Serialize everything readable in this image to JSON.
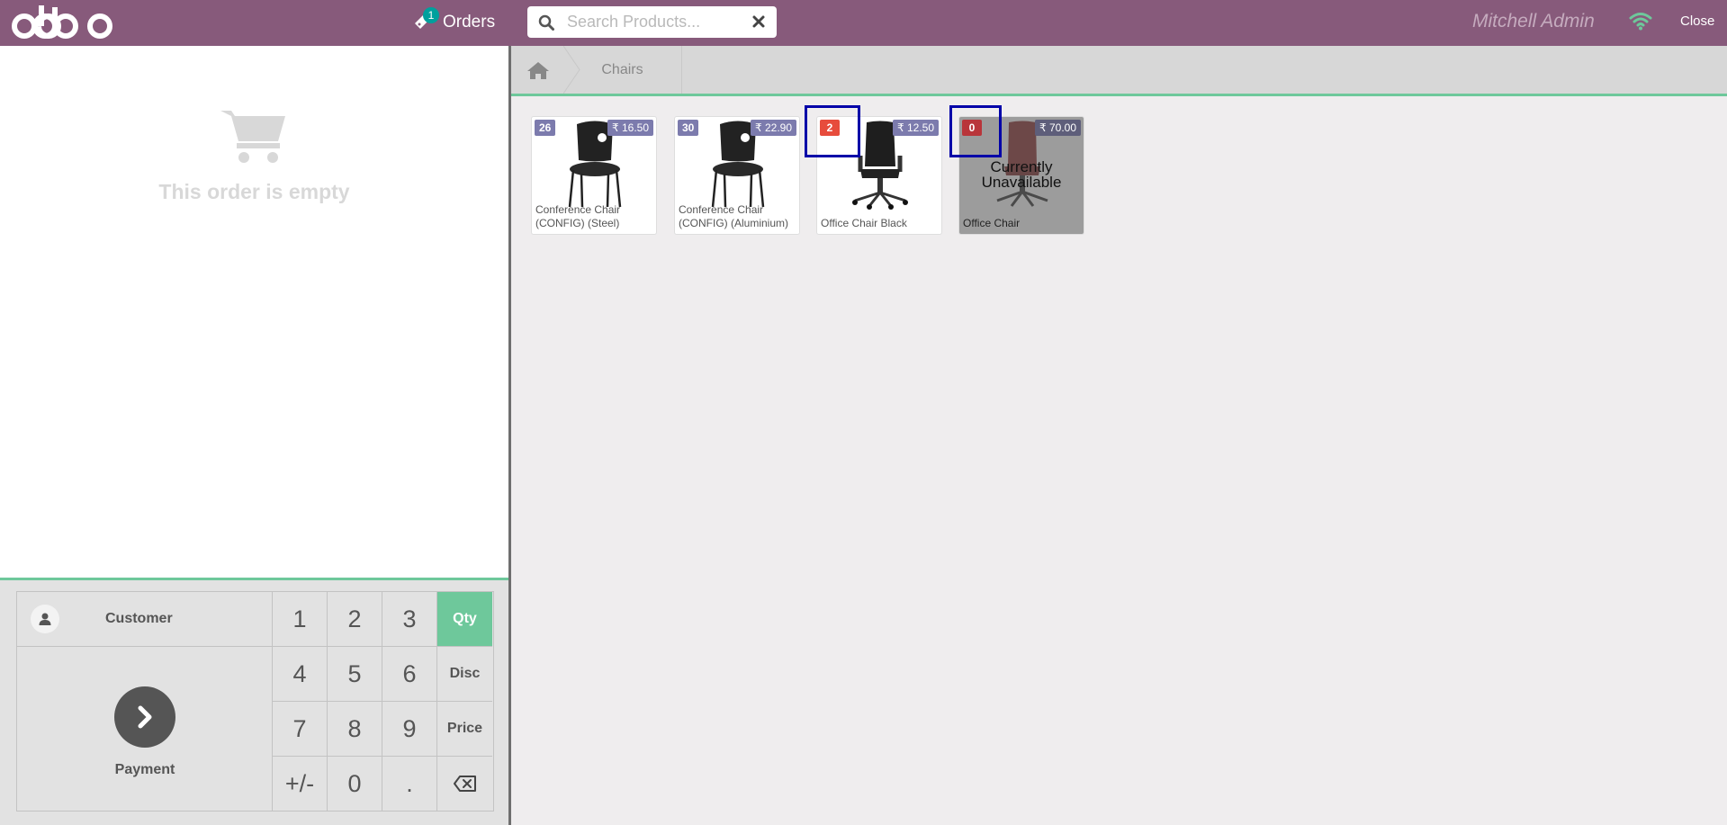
{
  "header": {
    "orders_label": "Orders",
    "orders_count": "1",
    "search_placeholder": "Search Products...",
    "user_name": "Mitchell Admin",
    "close_label": "Close",
    "brand_color": "#875a7b"
  },
  "order": {
    "empty_text": "This order is empty"
  },
  "pad": {
    "customer_label": "Customer",
    "payment_label": "Payment",
    "keys": [
      "1",
      "2",
      "3",
      "Qty",
      "4",
      "5",
      "6",
      "Disc",
      "7",
      "8",
      "9",
      "Price",
      "+/-",
      "0",
      "."
    ],
    "active_mode": "Qty",
    "accent_color": "#6ec89b"
  },
  "breadcrumb": {
    "category": "Chairs"
  },
  "products": [
    {
      "name": "Conference Chair (CONFIG) (Steel)",
      "price": "₹ 16.50",
      "stock": "26",
      "available": true
    },
    {
      "name": "Conference Chair (CONFIG) (Aluminium)",
      "price": "₹ 22.90",
      "stock": "30",
      "available": true
    },
    {
      "name": "Office Chair Black",
      "price": "₹ 12.50",
      "stock": "2",
      "available": true
    },
    {
      "name": "Office Chair",
      "price": "₹ 70.00",
      "stock": "0",
      "available": false,
      "status": "Currently Unavailable"
    }
  ]
}
